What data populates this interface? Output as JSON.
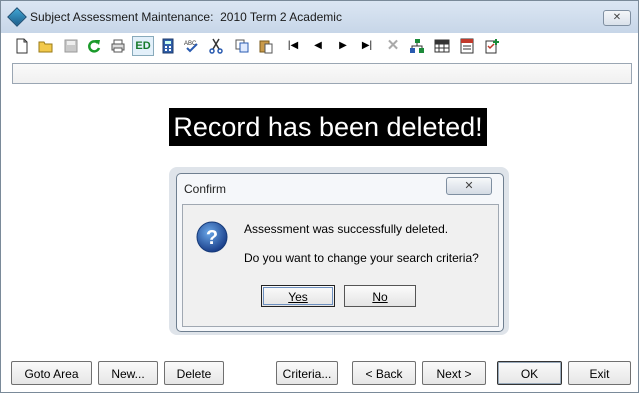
{
  "window": {
    "title": "Subject Assessment Maintenance:  2010 Term 2 Academic",
    "close_glyph": "✕"
  },
  "toolbar": {
    "icons": [
      "new-document",
      "open-folder",
      "save",
      "refresh",
      "print",
      "edit-mode",
      "calculator",
      "spell-check",
      "cut",
      "copy",
      "paste",
      "first-record",
      "previous-record",
      "next-record",
      "last-record",
      "delete",
      "tree-view",
      "grid-view",
      "reports",
      "checklist"
    ],
    "edit_label": "ED"
  },
  "banner": {
    "text": "Record has been deleted!"
  },
  "dialog": {
    "title": "Confirm",
    "close_glyph": "✕",
    "message_line1": "Assessment was successfully deleted.",
    "message_line2": "Do you want to change your search criteria?",
    "yes_label": "Yes",
    "no_label": "No"
  },
  "buttons": {
    "goto_area": "Goto Area",
    "new": "New...",
    "delete": "Delete",
    "criteria": "Criteria...",
    "back": "< Back",
    "next": "Next >",
    "ok": "OK",
    "exit": "Exit"
  },
  "colors": {
    "banner_bg": "#000000",
    "banner_text": "#ffffff",
    "title_bar": "#c7d6e8"
  }
}
